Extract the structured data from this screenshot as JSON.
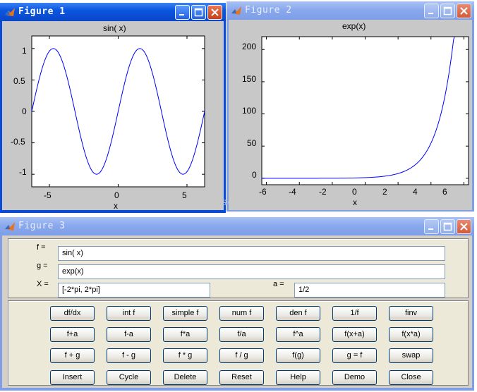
{
  "figure1": {
    "title": "Figure 1",
    "plot_title": "sin( x)",
    "xlabel": "x",
    "xticks": [
      "-5",
      "0",
      "5"
    ],
    "yticks": [
      "1",
      "0.5",
      "0",
      "-0.5",
      "-1"
    ]
  },
  "figure2": {
    "title": "Figure 2",
    "plot_title": "exp(x)",
    "xlabel": "x",
    "xticks": [
      "-6",
      "-4",
      "-2",
      "0",
      "2",
      "4",
      "6"
    ],
    "yticks": [
      "200",
      "150",
      "100",
      "50",
      "0"
    ]
  },
  "figure3": {
    "title": "Figure 3",
    "f_label": "f =",
    "f_value": "sin( x)",
    "g_label": "g =",
    "g_value": "exp(x)",
    "x_label": "X =",
    "x_value": "[-2*pi, 2*pi]",
    "a_label": "a =",
    "a_value": "1/2",
    "buttons": [
      [
        "df/dx",
        "int f",
        "simple f",
        "num f",
        "den f",
        "1/f",
        "finv"
      ],
      [
        "f+a",
        "f-a",
        "f*a",
        "f/a",
        "f^a",
        "f(x+a)",
        "f(x*a)"
      ],
      [
        "f + g",
        "f - g",
        "f * g",
        "f / g",
        "f(g)",
        "g = f",
        "swap"
      ],
      [
        "Insert",
        "Cycle",
        "Delete",
        "Reset",
        "Help",
        "Demo",
        "Close"
      ]
    ]
  },
  "watermark": "http://blog.csdn.net/gtx_11",
  "chart_data": [
    {
      "type": "line",
      "title": "sin( x)",
      "xlabel": "x",
      "ylabel": "",
      "function": "sin(x)",
      "xlim": [
        -6.2832,
        6.2832
      ],
      "ylim": [
        -1.2,
        1.2
      ],
      "x": [
        -6.283,
        -5.498,
        -4.712,
        -3.927,
        -3.142,
        -2.356,
        -1.571,
        -0.785,
        0,
        0.785,
        1.571,
        2.356,
        3.142,
        3.927,
        4.712,
        5.498,
        6.283
      ],
      "y": [
        0,
        0.707,
        1,
        0.707,
        0,
        -0.707,
        -1,
        -0.707,
        0,
        0.707,
        1,
        0.707,
        0,
        -0.707,
        -1,
        -0.707,
        0
      ],
      "series": [
        {
          "color": "#0000ff"
        }
      ]
    },
    {
      "type": "line",
      "title": "exp(x)",
      "xlabel": "x",
      "ylabel": "",
      "function": "exp(x)",
      "xlim": [
        -6.2832,
        6.2832
      ],
      "ylim": [
        -10,
        220
      ],
      "x": [
        -6,
        -4,
        -2,
        0,
        1,
        2,
        3,
        4,
        4.5,
        5,
        5.38
      ],
      "y": [
        0.0025,
        0.018,
        0.135,
        1,
        2.72,
        7.39,
        20.09,
        54.6,
        90.0,
        148.4,
        217.0
      ],
      "series": [
        {
          "color": "#0000ff"
        }
      ]
    }
  ]
}
